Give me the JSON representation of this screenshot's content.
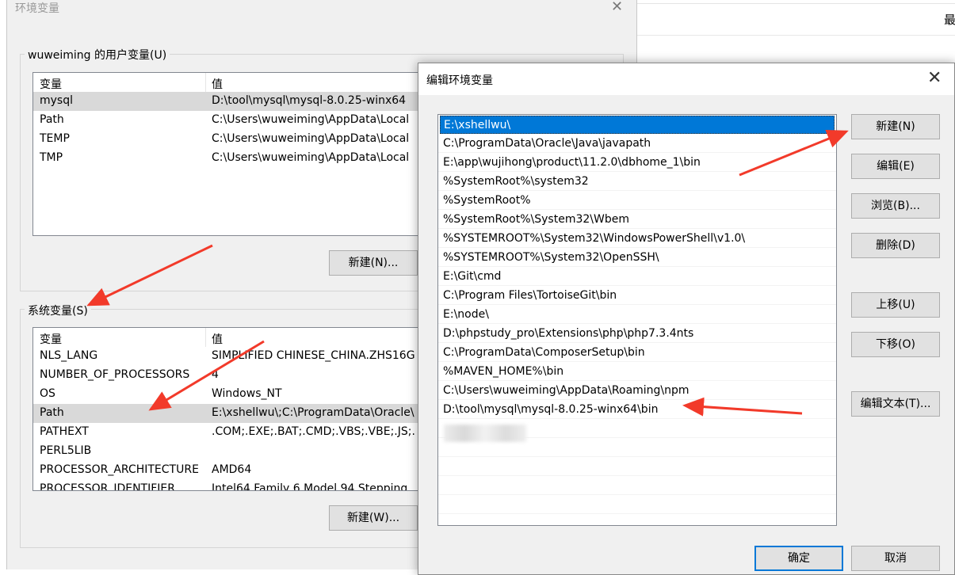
{
  "background_window": {
    "clipped_text": "最"
  },
  "env_dialog": {
    "title": "环境变量",
    "close_glyph": "✕",
    "user_vars": {
      "group_label": "wuweiming 的用户变量(U)",
      "col_variable": "变量",
      "col_value": "值",
      "rows": [
        {
          "name": "mysql",
          "value": "D:\\tool\\mysql\\mysql-8.0.25-winx64"
        },
        {
          "name": "Path",
          "value": "C:\\Users\\wuweiming\\AppData\\Local"
        },
        {
          "name": "TEMP",
          "value": "C:\\Users\\wuweiming\\AppData\\Local"
        },
        {
          "name": "TMP",
          "value": "C:\\Users\\wuweiming\\AppData\\Local"
        }
      ],
      "new_button": "新建(N)..."
    },
    "system_vars": {
      "group_label": "系统变量(S)",
      "col_variable": "变量",
      "col_value": "值",
      "rows": [
        {
          "name": "NLS_LANG",
          "value": "SIMPLIFIED CHINESE_CHINA.ZHS16G"
        },
        {
          "name": "NUMBER_OF_PROCESSORS",
          "value": "4"
        },
        {
          "name": "OS",
          "value": "Windows_NT"
        },
        {
          "name": "Path",
          "value": "E:\\xshellwu\\;C:\\ProgramData\\Oracle\\"
        },
        {
          "name": "PATHEXT",
          "value": ".COM;.EXE;.BAT;.CMD;.VBS;.VBE;.JS;."
        },
        {
          "name": "PERL5LIB",
          "value": ""
        },
        {
          "name": "PROCESSOR_ARCHITECTURE",
          "value": "AMD64"
        },
        {
          "name": "PROCESSOR_IDENTIFIER",
          "value": "Intel64 Family 6 Model 94 Stepping"
        }
      ],
      "new_button": "新建(W)..."
    }
  },
  "edit_dialog": {
    "title": "编辑环境变量",
    "close_glyph": "✕",
    "paths": [
      "E:\\xshellwu\\",
      "C:\\ProgramData\\Oracle\\Java\\javapath",
      "E:\\app\\wujihong\\product\\11.2.0\\dbhome_1\\bin",
      "%SystemRoot%\\system32",
      "%SystemRoot%",
      "%SystemRoot%\\System32\\Wbem",
      "%SYSTEMROOT%\\System32\\WindowsPowerShell\\v1.0\\",
      "%SYSTEMROOT%\\System32\\OpenSSH\\",
      "E:\\Git\\cmd",
      "C:\\Program Files\\TortoiseGit\\bin",
      "E:\\node\\",
      "D:\\phpstudy_pro\\Extensions\\php\\php7.3.4nts",
      "C:\\ProgramData\\ComposerSetup\\bin",
      "%MAVEN_HOME%\\bin",
      "C:\\Users\\wuweiming\\AppData\\Roaming\\npm",
      "D:\\tool\\mysql\\mysql-8.0.25-winx64\\bin"
    ],
    "buttons": {
      "new": "新建(N)",
      "edit": "编辑(E)",
      "browse": "浏览(B)...",
      "delete": "删除(D)",
      "move_up": "上移(U)",
      "move_down": "下移(O)",
      "edit_text": "编辑文本(T)...",
      "ok": "确定",
      "cancel": "取消"
    }
  },
  "colors": {
    "selection": "#0078d7",
    "annotation_arrow": "#f23a2a"
  }
}
